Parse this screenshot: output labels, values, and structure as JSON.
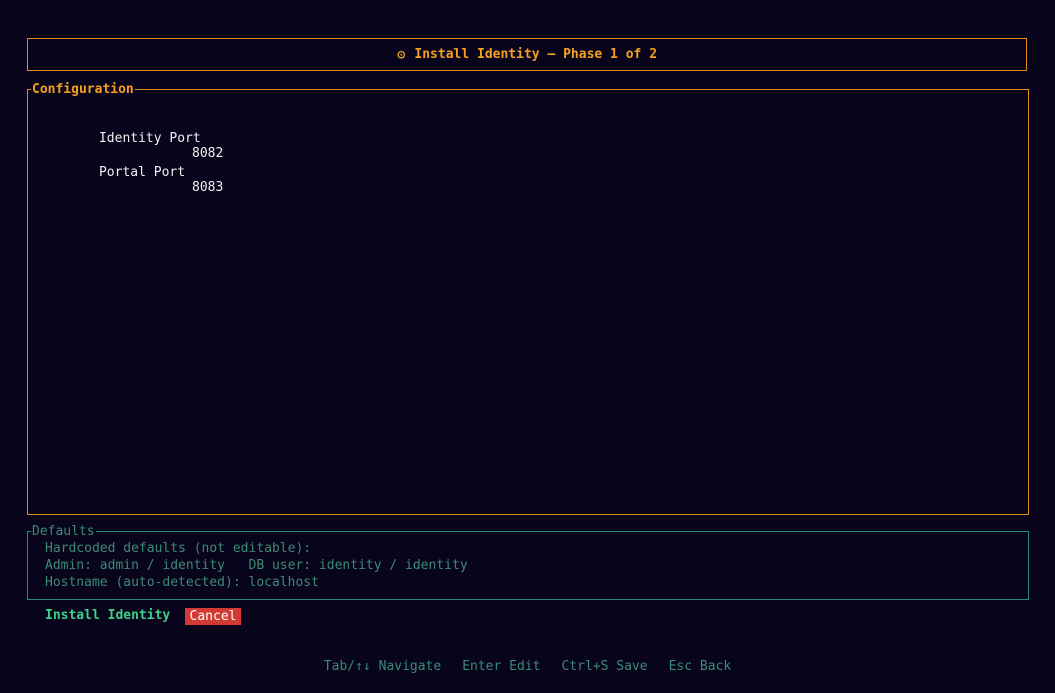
{
  "header": {
    "icon": "gear-icon",
    "title": "Install Identity — Phase 1 of 2"
  },
  "configuration": {
    "legend": "Configuration",
    "fields": [
      {
        "label": "Identity Port",
        "value": "8082"
      },
      {
        "label": "Portal Port",
        "value": "8083"
      }
    ]
  },
  "defaults": {
    "legend": "Defaults",
    "lines": [
      "Hardcoded defaults (not editable):",
      "Admin: admin / identity   DB user: identity / identity",
      "Hostname (auto-detected): localhost"
    ]
  },
  "actions": {
    "install_label": "Install Identity",
    "cancel_label": "Cancel"
  },
  "hints": [
    "Tab/↑↓ Navigate",
    "Enter Edit",
    "Ctrl+S Save",
    "Esc Back"
  ],
  "colors": {
    "background": "#07041b",
    "accent_orange": "#f5a020",
    "border_orange": "#e08a1c",
    "muted_green": "#3d8a74",
    "bright_green": "#3ed089",
    "danger_red": "#d23a33"
  }
}
